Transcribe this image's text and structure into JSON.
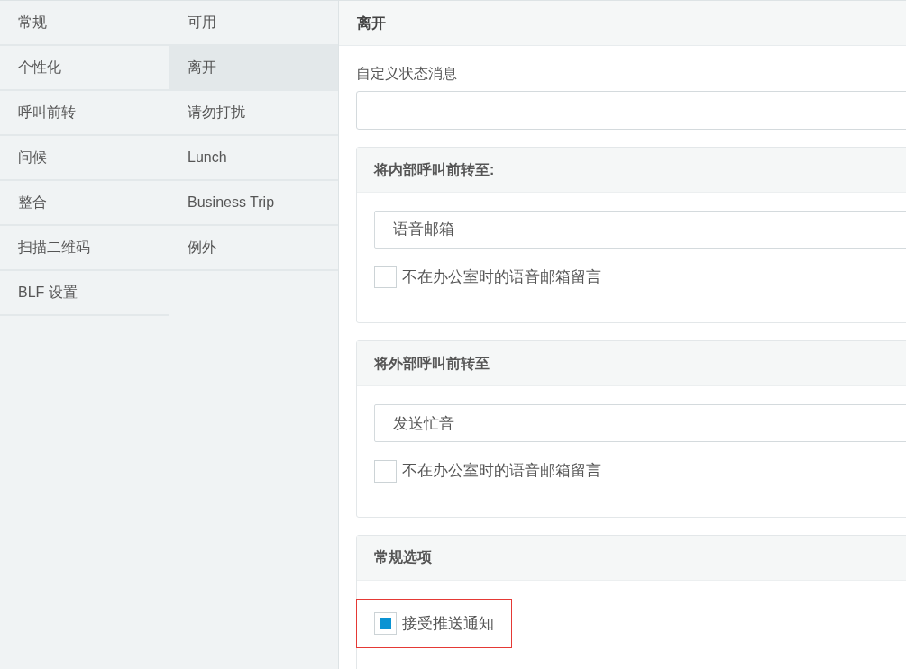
{
  "categories": [
    {
      "label": "常规",
      "selected": false
    },
    {
      "label": "个性化",
      "selected": false
    },
    {
      "label": "呼叫前转",
      "selected": false
    },
    {
      "label": "问候",
      "selected": false
    },
    {
      "label": "整合",
      "selected": false
    },
    {
      "label": "扫描二维码",
      "selected": false
    },
    {
      "label": "BLF 设置",
      "selected": false
    }
  ],
  "statuses": [
    {
      "label": "可用",
      "selected": false
    },
    {
      "label": "离开",
      "selected": true
    },
    {
      "label": "请勿打扰",
      "selected": false
    },
    {
      "label": "Lunch",
      "selected": false
    },
    {
      "label": "Business Trip",
      "selected": false
    },
    {
      "label": "例外",
      "selected": false
    }
  ],
  "main": {
    "title": "离开",
    "status_message": {
      "label": "自定义状态消息"
    },
    "sections": [
      {
        "title": "将内部呼叫前转至:",
        "select": {
          "value": "语音邮箱"
        },
        "options": [
          {
            "label": "不在办公室时的语音邮箱留言",
            "checked": false,
            "highlighted": false
          }
        ]
      },
      {
        "title": "将外部呼叫前转至",
        "select": {
          "value": "发送忙音"
        },
        "options": [
          {
            "label": "不在办公室时的语音邮箱留言",
            "checked": false,
            "highlighted": false
          }
        ]
      },
      {
        "title": "常规选项",
        "options": [
          {
            "label": "接受推送通知",
            "checked": true,
            "highlighted": true
          }
        ]
      }
    ]
  }
}
